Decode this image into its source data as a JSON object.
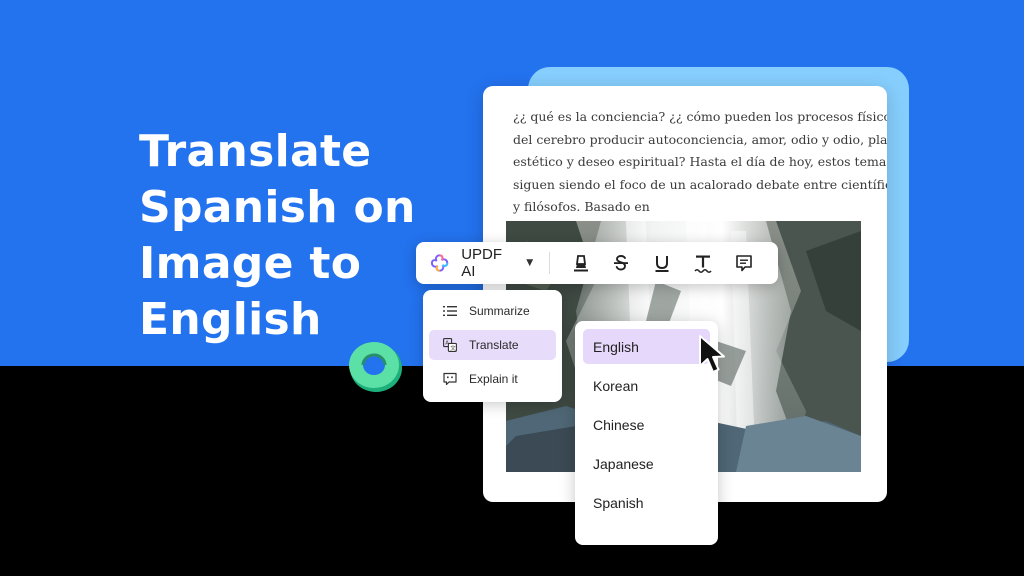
{
  "headline": {
    "lines": [
      "Translate",
      "Spanish on",
      "Image to",
      "English"
    ]
  },
  "document": {
    "lines": [
      "¿¿ qué es la conciencia? ¿¿ cómo pueden los procesos físicos",
      "del cerebro producir autoconciencia, amor, odio y odio, placer",
      "estético y deseo espiritual? Hasta el día de hoy, estos temas",
      "siguen siendo el foco de un acalorado debate entre científicos",
      "y filósofos. Basado en"
    ]
  },
  "toolbar": {
    "ai_label": "UPDF AI",
    "ai_icon": "updf-ai-logo-icon",
    "caret_icon": "caret-down-icon",
    "tools": [
      "highlight-icon",
      "strikethrough-icon",
      "underline-icon",
      "squiggly-text-icon",
      "comment-icon"
    ]
  },
  "ai_menu": {
    "items": [
      {
        "label": "Summarize",
        "icon": "list-icon"
      },
      {
        "label": "Translate",
        "icon": "translate-icon"
      },
      {
        "label": "Explain it",
        "icon": "chat-bubble-icon"
      }
    ],
    "selected": "Translate"
  },
  "language_menu": {
    "items": [
      "English",
      "Korean",
      "Chinese",
      "Japanese",
      "Spanish"
    ],
    "selected": "English"
  },
  "colors": {
    "background_blue": "#2372ee",
    "background_black": "#000000",
    "accent_light_blue": "#86cefd",
    "highlight_purple": "#e8dcfb"
  }
}
